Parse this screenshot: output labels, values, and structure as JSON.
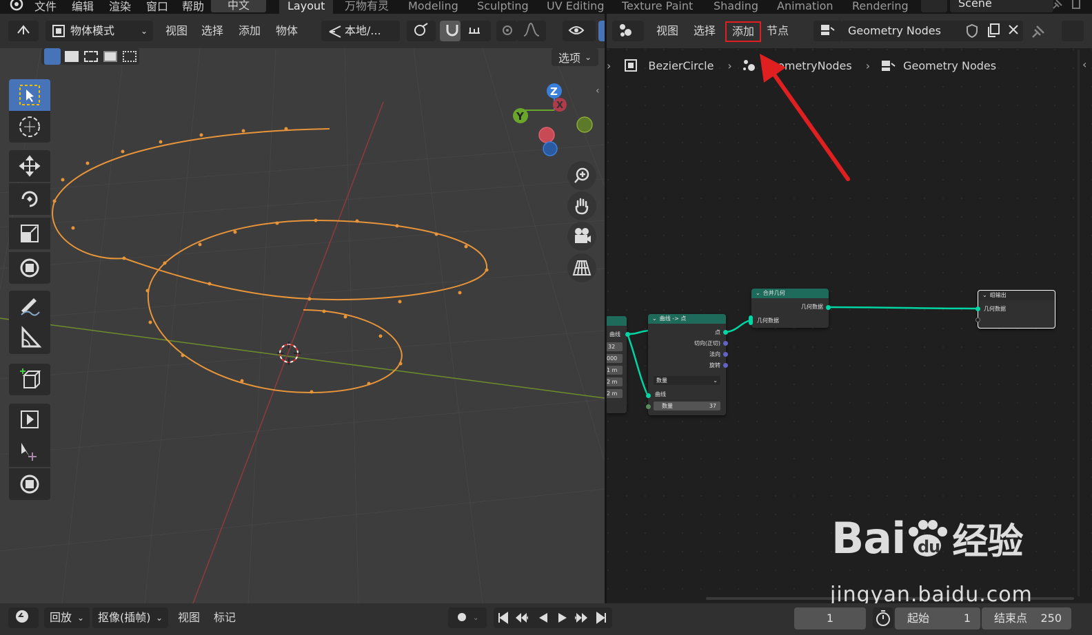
{
  "app": {
    "logo": "blender-logo-icon"
  },
  "menu": {
    "file": "文件",
    "edit": "编辑",
    "render": "渲染",
    "window": "窗口",
    "help": "帮助",
    "lang": "中文"
  },
  "workspaces": [
    "Layout",
    "万物有灵",
    "Modeling",
    "Sculpting",
    "UV Editing",
    "Texture Paint",
    "Shading",
    "Animation",
    "Rendering"
  ],
  "scene": {
    "name": "Scene"
  },
  "viewport": {
    "mode": "物体模式",
    "menu": [
      "视图",
      "选择",
      "添加",
      "物体"
    ],
    "orientation": "本地/...",
    "options": "选项"
  },
  "node_editor": {
    "menu": [
      "视图",
      "选择",
      "添加",
      "节点"
    ],
    "tree_name": "Geometry Nodes",
    "breadcrumb": [
      "BezierCircle",
      "GeometryNodes",
      "Geometry Nodes"
    ],
    "highlighted_menu": "添加"
  },
  "nodes": {
    "partial": {
      "label": "曲线",
      "values": [
        "32",
        "000",
        "1 m",
        "2 m",
        "2 m"
      ]
    },
    "curve_to_points": {
      "title": "曲线 -> 点",
      "outputs": [
        "点",
        "切向(正切)",
        "法向",
        "旋转"
      ],
      "mode": "数量",
      "input": "曲线",
      "count_label": "数量",
      "count_value": "37"
    },
    "join": {
      "title": "合并几何",
      "output": "几何数据",
      "input": "几何数据"
    },
    "group_output": {
      "title": "组输出",
      "input": "几何数据"
    }
  },
  "timeline": {
    "playback": "回放",
    "keying": "抠像(插帧)",
    "view": "视图",
    "marker": "标记",
    "current_frame": "1",
    "start_label": "起始",
    "start": "1",
    "end_label": "结束点",
    "end": "250"
  },
  "watermark": {
    "brand": "Bai",
    "brand2": "du",
    "cn": "经验",
    "url": "jingyan.baidu.com"
  },
  "colors": {
    "accent": "#4774b8",
    "node_header": "#1f6b5b",
    "curve": "#e8953a",
    "highlight": "#e02020",
    "geometry_socket": "#00d6a3"
  }
}
